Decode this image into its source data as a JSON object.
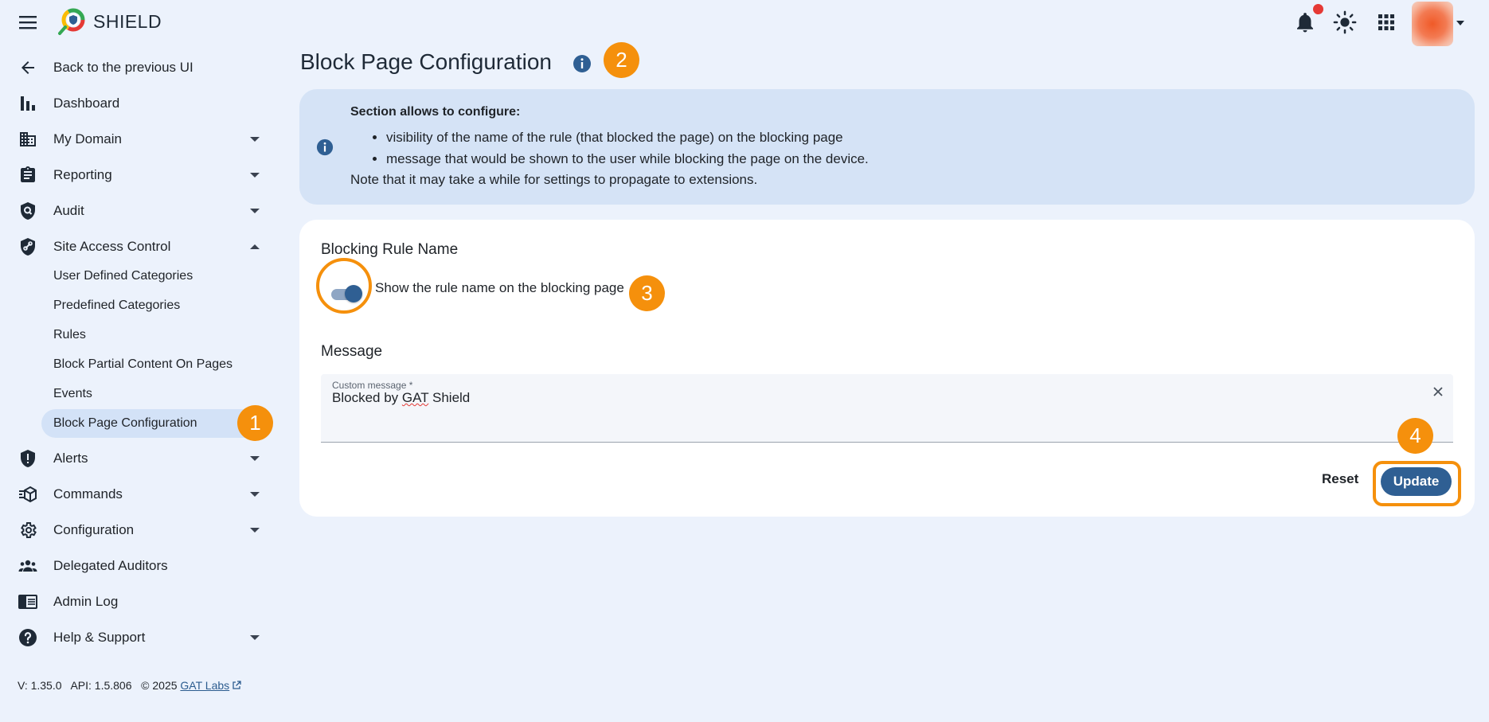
{
  "app": {
    "brand": "SHIELD"
  },
  "topbar": {
    "icons": [
      "menu-icon",
      "notifications-icon",
      "brightness-icon",
      "apps-grid-icon",
      "user-avatar"
    ],
    "notification_dot_color": "#e53935"
  },
  "sidebar": {
    "back": "Back to the previous UI",
    "items": [
      {
        "label": "Dashboard",
        "icon": "bar-chart-icon"
      },
      {
        "label": "My Domain",
        "icon": "domain-icon",
        "expandable": true
      },
      {
        "label": "Reporting",
        "icon": "clipboard-icon",
        "expandable": true
      },
      {
        "label": "Audit",
        "icon": "audit-icon",
        "expandable": true
      },
      {
        "label": "Site Access Control",
        "icon": "shield-link-icon",
        "expanded": true
      },
      {
        "label": "Alerts",
        "icon": "alert-shield-icon",
        "expandable": true
      },
      {
        "label": "Commands",
        "icon": "commands-icon",
        "expandable": true
      },
      {
        "label": "Configuration",
        "icon": "gear-icon",
        "expandable": true
      },
      {
        "label": "Delegated Auditors",
        "icon": "people-icon"
      },
      {
        "label": "Admin Log",
        "icon": "log-icon"
      },
      {
        "label": "Help & Support",
        "icon": "help-icon",
        "expandable": true
      }
    ],
    "sub_items": [
      {
        "label": "User Defined Categories"
      },
      {
        "label": "Predefined Categories"
      },
      {
        "label": "Rules"
      },
      {
        "label": "Block Partial Content On Pages"
      },
      {
        "label": "Events"
      },
      {
        "label": "Block Page Configuration",
        "active": true
      }
    ]
  },
  "footer": {
    "version": "V: 1.35.0",
    "api": "API: 1.5.806",
    "copyright": "© 2025",
    "company_link": "GAT Labs"
  },
  "main": {
    "title": "Block Page Configuration",
    "info": {
      "heading": "Section allows to configure:",
      "bullets": [
        "visibility of the name of the rule (that blocked the page) on the blocking page",
        "message that would be shown to the user while blocking the page on the device."
      ],
      "note": "Note that it may take a while for settings to propagate to extensions."
    },
    "rule_name_section": {
      "title": "Blocking Rule Name",
      "toggle_label": "Show the rule name on the blocking page",
      "toggle_on": true
    },
    "message_section": {
      "title": "Message",
      "field_label": "Custom message *",
      "field_value_prefix": "Blocked by ",
      "field_value_misspelled": "GAT",
      "field_value_suffix": " Shield"
    },
    "actions": {
      "reset": "Reset",
      "update": "Update"
    }
  },
  "annotations": {
    "color": "#f5900c",
    "badges": [
      "1",
      "2",
      "3",
      "4"
    ]
  },
  "colors": {
    "background": "#ecf2fc",
    "primary": "#2f5f93",
    "info_box": "#d5e3f6",
    "active_nav": "#d3e2f7",
    "annotation": "#f5900c"
  }
}
